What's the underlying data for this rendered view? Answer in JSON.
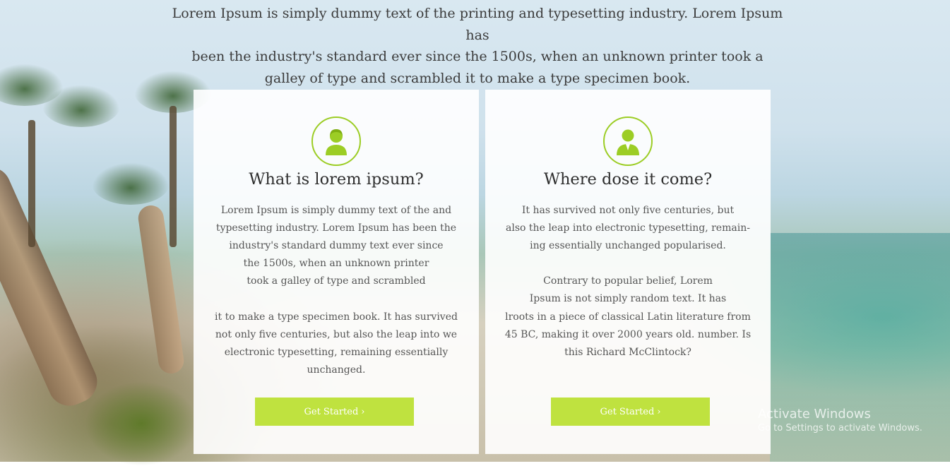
{
  "intro": {
    "lines": [
      "Lorem Ipsum is simply dummy text of the printing and typesetting industry. Lorem Ipsum has",
      "been the industry's standard   ever since the 1500s, when an unknown printer took a",
      "galley of type and scrambled it to make a type specimen book."
    ]
  },
  "cards": [
    {
      "icon": "user-female-icon",
      "title": "What is lorem ipsum?",
      "body_lines": [
        "Lorem Ipsum is simply dummy text of the and",
        "typesetting industry. Lorem Ipsum has been the",
        "industry's standard dummy text ever since",
        "the 1500s, when an unknown printer",
        "took a galley of type and scrambled",
        "",
        "it to make a type specimen book. It has survived",
        "not only five centuries, but also the leap into we",
        "electronic typesetting, remaining essentially",
        "unchanged."
      ],
      "button_label": "Get Started",
      "button_arrow": "›"
    },
    {
      "icon": "user-male-icon",
      "title": "Where dose it come?",
      "body_lines": [
        "It has survived not only five centuries, but",
        "also the leap into electronic typesetting, remain-",
        "ing essentially unchanged popularised.",
        "",
        "Contrary to popular belief, Lorem",
        "Ipsum is not simply random text. It has",
        "lroots in a piece of classical Latin literature from",
        "45 BC, making it over 2000 years old. number. Is",
        "this Richard McClintock?"
      ],
      "button_label": "Get Started",
      "button_arrow": "›"
    }
  ],
  "watermark": {
    "title": "Activate Windows",
    "subtitle": "Go to Settings to activate Windows."
  },
  "colors": {
    "accent": "#9ccd25",
    "button": "#bfe23f"
  }
}
